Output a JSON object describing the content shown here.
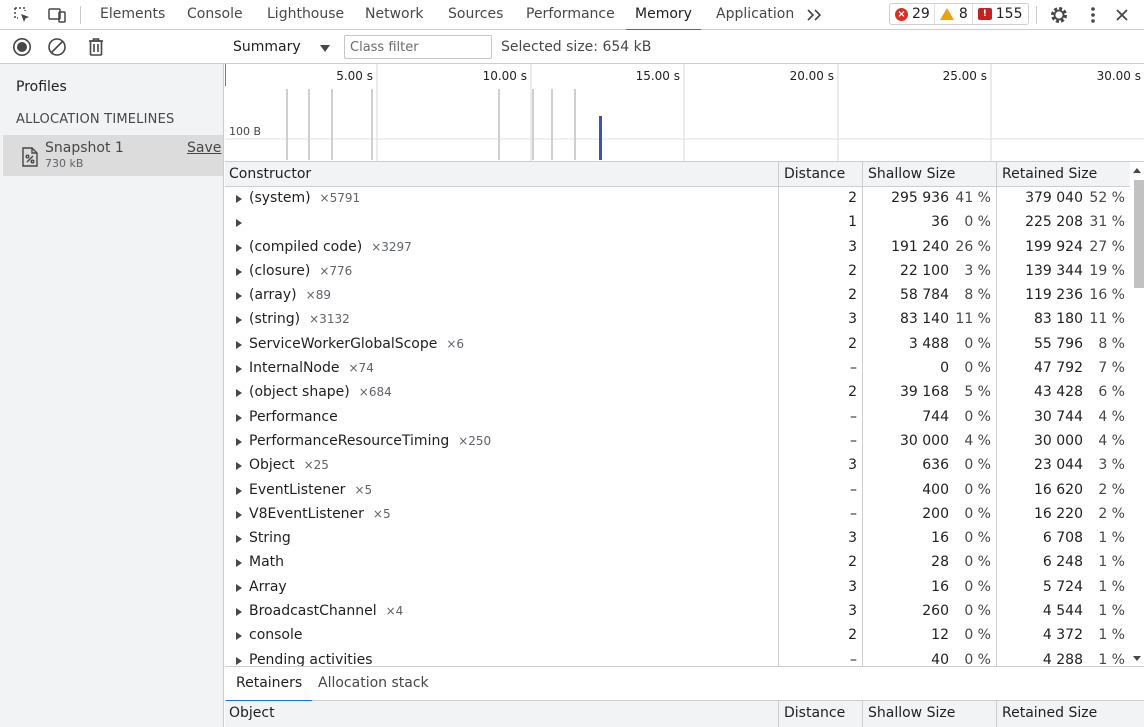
{
  "tabs": [
    {
      "label": "Elements",
      "name": "tab-elements"
    },
    {
      "label": "Console",
      "name": "tab-console"
    },
    {
      "label": "Lighthouse",
      "name": "tab-lighthouse"
    },
    {
      "label": "Network",
      "name": "tab-network"
    },
    {
      "label": "Sources",
      "name": "tab-sources"
    },
    {
      "label": "Performance",
      "name": "tab-performance"
    },
    {
      "label": "Memory",
      "name": "tab-memory",
      "selected": true
    },
    {
      "label": "Application",
      "name": "tab-application"
    }
  ],
  "badges": {
    "errors": "29",
    "warnings": "8",
    "issues": "155"
  },
  "toolbar": {
    "view": "Summary",
    "class_filter_placeholder": "Class filter",
    "selected_size": "Selected size: 654 kB"
  },
  "sidebar": {
    "profiles_label": "Profiles",
    "section_heading": "ALLOCATION TIMELINES",
    "snapshot": {
      "name": "Snapshot 1",
      "size": "730 kB",
      "save_label": "Save"
    }
  },
  "timeline": {
    "tick_labels": [
      "5.00 s",
      "10.00 s",
      "15.00 s",
      "20.00 s",
      "25.00 s",
      "30.00 s"
    ],
    "y_label": "100 B"
  },
  "grid": {
    "columns": [
      "Constructor",
      "Distance",
      "Shallow Size",
      "Retained Size"
    ],
    "rows": [
      {
        "name": "(system)",
        "count": "×5791",
        "distance": "2",
        "shallow": "295 936",
        "shallow_pct": "41 %",
        "retained": "379 040",
        "retained_pct": "52 %"
      },
      {
        "name": "",
        "count": "",
        "distance": "1",
        "shallow": "36",
        "shallow_pct": "0 %",
        "retained": "225 208",
        "retained_pct": "31 %"
      },
      {
        "name": "(compiled code)",
        "count": "×3297",
        "distance": "3",
        "shallow": "191 240",
        "shallow_pct": "26 %",
        "retained": "199 924",
        "retained_pct": "27 %"
      },
      {
        "name": "(closure)",
        "count": "×776",
        "distance": "2",
        "shallow": "22 100",
        "shallow_pct": "3 %",
        "retained": "139 344",
        "retained_pct": "19 %"
      },
      {
        "name": "(array)",
        "count": "×89",
        "distance": "2",
        "shallow": "58 784",
        "shallow_pct": "8 %",
        "retained": "119 236",
        "retained_pct": "16 %"
      },
      {
        "name": "(string)",
        "count": "×3132",
        "distance": "3",
        "shallow": "83 140",
        "shallow_pct": "11 %",
        "retained": "83 180",
        "retained_pct": "11 %"
      },
      {
        "name": "ServiceWorkerGlobalScope",
        "count": "×6",
        "distance": "2",
        "shallow": "3 488",
        "shallow_pct": "0 %",
        "retained": "55 796",
        "retained_pct": "8 %"
      },
      {
        "name": "InternalNode",
        "count": "×74",
        "distance": "–",
        "shallow": "0",
        "shallow_pct": "0 %",
        "retained": "47 792",
        "retained_pct": "7 %"
      },
      {
        "name": "(object shape)",
        "count": "×684",
        "distance": "2",
        "shallow": "39 168",
        "shallow_pct": "5 %",
        "retained": "43 428",
        "retained_pct": "6 %"
      },
      {
        "name": "Performance",
        "count": "",
        "distance": "–",
        "shallow": "744",
        "shallow_pct": "0 %",
        "retained": "30 744",
        "retained_pct": "4 %"
      },
      {
        "name": "PerformanceResourceTiming",
        "count": "×250",
        "distance": "–",
        "shallow": "30 000",
        "shallow_pct": "4 %",
        "retained": "30 000",
        "retained_pct": "4 %"
      },
      {
        "name": "Object",
        "count": "×25",
        "distance": "3",
        "shallow": "636",
        "shallow_pct": "0 %",
        "retained": "23 044",
        "retained_pct": "3 %"
      },
      {
        "name": "EventListener",
        "count": "×5",
        "distance": "–",
        "shallow": "400",
        "shallow_pct": "0 %",
        "retained": "16 620",
        "retained_pct": "2 %"
      },
      {
        "name": "V8EventListener",
        "count": "×5",
        "distance": "–",
        "shallow": "200",
        "shallow_pct": "0 %",
        "retained": "16 220",
        "retained_pct": "2 %"
      },
      {
        "name": "String",
        "count": "",
        "distance": "3",
        "shallow": "16",
        "shallow_pct": "0 %",
        "retained": "6 708",
        "retained_pct": "1 %"
      },
      {
        "name": "Math",
        "count": "",
        "distance": "2",
        "shallow": "28",
        "shallow_pct": "0 %",
        "retained": "6 248",
        "retained_pct": "1 %"
      },
      {
        "name": "Array",
        "count": "",
        "distance": "3",
        "shallow": "16",
        "shallow_pct": "0 %",
        "retained": "5 724",
        "retained_pct": "1 %"
      },
      {
        "name": "BroadcastChannel",
        "count": "×4",
        "distance": "3",
        "shallow": "260",
        "shallow_pct": "0 %",
        "retained": "4 544",
        "retained_pct": "1 %"
      },
      {
        "name": "console",
        "count": "",
        "distance": "2",
        "shallow": "12",
        "shallow_pct": "0 %",
        "retained": "4 372",
        "retained_pct": "1 %"
      },
      {
        "name": "Pending activities",
        "count": "",
        "distance": "–",
        "shallow": "40",
        "shallow_pct": "0 %",
        "retained": "4 288",
        "retained_pct": "1 %"
      }
    ]
  },
  "bottom": {
    "tabs": [
      {
        "label": "Retainers",
        "selected": true
      },
      {
        "label": "Allocation stack"
      }
    ],
    "columns": [
      "Object",
      "Distance",
      "Shallow Size",
      "Retained Size"
    ]
  },
  "colors": {
    "accent": "#1a73e8",
    "error": "#d93025",
    "warning": "#e8a40c",
    "issue": "#c5221f",
    "timeline_highlight": "#3f51b5"
  }
}
